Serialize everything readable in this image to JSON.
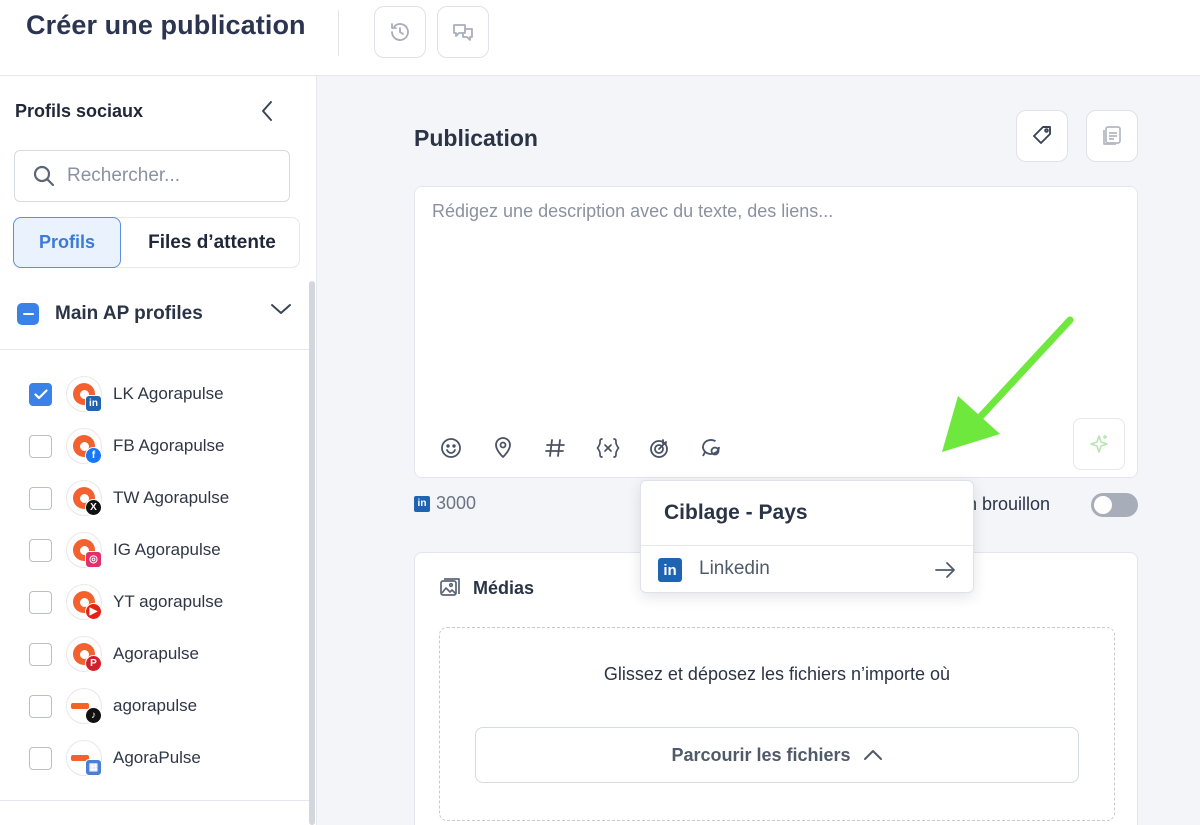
{
  "header": {
    "title": "Créer une publication",
    "history_icon": "history-icon",
    "comments_icon": "comments-icon"
  },
  "sidebar": {
    "title": "Profils sociaux",
    "search_placeholder": "Rechercher...",
    "tabs": [
      {
        "label": "Profils",
        "active": true
      },
      {
        "label": "Files d’attente",
        "active": false
      }
    ],
    "group": {
      "label": "Main AP profiles",
      "state": "partial"
    },
    "profiles": [
      {
        "name": "LK Agorapulse",
        "network": "linkedin",
        "checked": true
      },
      {
        "name": "FB Agorapulse",
        "network": "facebook",
        "checked": false
      },
      {
        "name": "TW Agorapulse",
        "network": "x",
        "checked": false
      },
      {
        "name": "IG Agorapulse",
        "network": "instagram",
        "checked": false
      },
      {
        "name": "YT agorapulse",
        "network": "youtube",
        "checked": false
      },
      {
        "name": "Agorapulse",
        "network": "pinterest",
        "checked": false
      },
      {
        "name": "agorapulse",
        "network": "tiktok",
        "checked": false
      },
      {
        "name": "AgoraPulse",
        "network": "google-business",
        "checked": false
      }
    ]
  },
  "main": {
    "section_title": "Publication",
    "editor_placeholder": "Rédigez une description avec du texte, des liens...",
    "toolbar": [
      "emoji-icon",
      "location-icon",
      "hashtag-icon",
      "variable-icon",
      "targeting-icon",
      "comment-icon"
    ],
    "char_count": "3000",
    "draft_label": "n brouillon",
    "draft_enabled": false,
    "media": {
      "title": "Médias",
      "drop_text": "Glissez et déposez les fichiers n’importe où",
      "browse_label": "Parcourir les fichiers"
    }
  },
  "popover": {
    "title": "Ciblage - Pays",
    "item_label": "Linkedin"
  },
  "colors": {
    "accent": "#3a82e6",
    "linkedin": "#1f64b3",
    "annotation_arrow": "#6ee83c"
  }
}
